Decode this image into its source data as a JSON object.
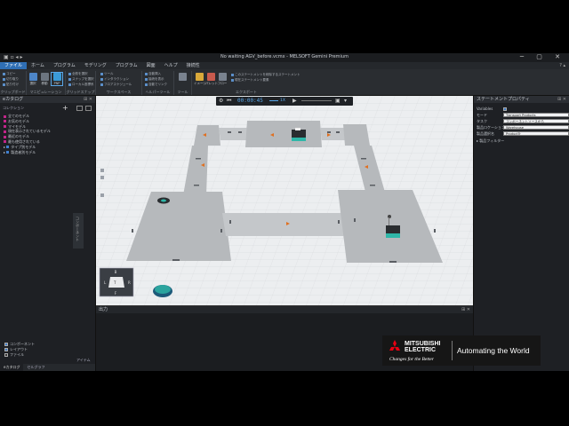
{
  "window": {
    "title": "No waiting AGV_before.vcmx - MELSOFT Gemini Premium",
    "controls": "─ ▢ ✕"
  },
  "menu": {
    "items": [
      "ファイル",
      "ホーム",
      "プログラム",
      "モデリング",
      "プログラム",
      "図面",
      "ヘルプ",
      "接続性"
    ],
    "active_index": 0
  },
  "ribbon": {
    "groups": [
      {
        "label": "クリップボード"
      },
      {
        "label": "マニピュレーション"
      },
      {
        "label": "グリッドスナップ"
      },
      {
        "label": "ワークスペース"
      },
      {
        "label": "ヘルパーツール"
      },
      {
        "label": "ツール"
      },
      {
        "label": "エクスポート"
      }
    ],
    "buttons": [
      "選択",
      "移動",
      "PNP",
      "イメージ",
      "パレット",
      "フロー"
    ],
    "small_items": [
      "コピー",
      "切り取り",
      "貼り付け",
      "全般を選択",
      "スナップを選択",
      "ローカル座標系",
      "ツール",
      "インタラクション",
      "フロアスケジュール",
      "自動挿入",
      "接続を表示",
      "自動でリンク"
    ],
    "notes": [
      "このステートメントを削除するステートメント",
      "現在ステートメント要素"
    ]
  },
  "left_panel": {
    "title": "eカタログ",
    "section": "コレクション",
    "tree": [
      {
        "label": "全てのモデル",
        "color": "#c2268a"
      },
      {
        "label": "お気のモデル",
        "color": "#c2268a"
      },
      {
        "label": "マイモデル",
        "color": "#c2268a"
      },
      {
        "label": "現在表示されているモデル",
        "color": "#c2268a"
      },
      {
        "label": "最近のモデル",
        "color": "#c2268a"
      },
      {
        "label": "最も使用されている",
        "color": "#c2268a"
      },
      {
        "label": "タイプ別モデル",
        "color": "#3f7fd0"
      },
      {
        "label": "製造者別モデル",
        "color": "#3f7fd0"
      }
    ],
    "checks": [
      {
        "label": "コンポーネント",
        "checked": true
      },
      {
        "label": "レイアウト",
        "checked": true
      },
      {
        "label": "ファイル",
        "checked": false
      }
    ],
    "side_tab": "コンポーネント",
    "bottom_label": "アイテム",
    "bottom_tabs": [
      "eカタログ",
      "セルグラフ"
    ]
  },
  "viewport_toolbar": {
    "time": "00:00:45",
    "speed": "1X"
  },
  "output_panel": {
    "title": "出力"
  },
  "right_panel": {
    "title": "ステートメントプロパティ",
    "props": [
      {
        "key": "Variables",
        "value": ""
      },
      {
        "key": "モード",
        "value": "Transport Products"
      },
      {
        "key": "タスク",
        "value": "コンポーネントソースから"
      },
      {
        "key": "製品ロケーション",
        "value": "Warehouse"
      },
      {
        "key": "製品選択名",
        "value": "ProductTr"
      }
    ],
    "filter": "製品フィルター"
  },
  "logo": {
    "brand_line1": "MITSUBISHI",
    "brand_line2": "ELECTRIC",
    "tagline": "Changes for the Better",
    "slogan": "Automating the World",
    "color": "#e60012"
  }
}
